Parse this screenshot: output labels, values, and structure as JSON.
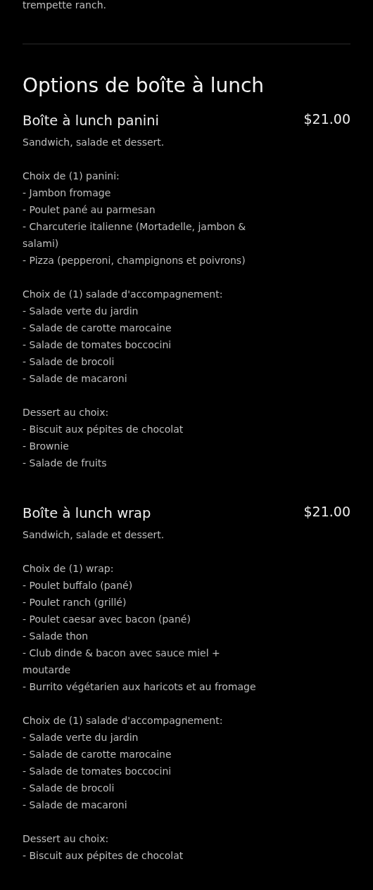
{
  "intro_tail": "trempette ranch.",
  "section_title": "Options de boîte à lunch",
  "items": [
    {
      "name": "Boîte à lunch panini",
      "price": "$21.00",
      "paragraphs": [
        [
          "Sandwich, salade et dessert."
        ],
        [
          "Choix de (1) panini:",
          "- Jambon fromage",
          "- Poulet pané au parmesan",
          "- Charcuterie italienne (Mortadelle, jambon & salami)",
          "- Pizza (pepperoni, champignons et poivrons)"
        ],
        [
          "Choix de (1) salade d'accompagnement:",
          "- Salade verte du jardin",
          "- Salade de carotte marocaine",
          "- Salade de tomates boccocini",
          "- Salade de brocoli",
          "- Salade de macaroni"
        ],
        [
          "Dessert au choix:",
          "- Biscuit aux pépites de chocolat",
          "- Brownie",
          "- Salade de fruits"
        ]
      ]
    },
    {
      "name": "Boîte à lunch wrap",
      "price": "$21.00",
      "paragraphs": [
        [
          "Sandwich, salade et dessert."
        ],
        [
          "Choix de (1) wrap:",
          "- Poulet buffalo (pané)",
          "- Poulet ranch (grillé)",
          "- Poulet caesar avec bacon (pané)",
          "- Salade thon",
          "- Club dinde & bacon avec sauce miel + moutarde",
          "- Burrito végétarien aux haricots et au fromage"
        ],
        [
          "Choix de (1) salade d'accompagnement:",
          "- Salade verte du jardin",
          "- Salade de carotte marocaine",
          "- Salade de tomates boccocini",
          "- Salade de brocoli",
          "- Salade de macaroni"
        ],
        [
          "Dessert au choix:",
          "- Biscuit aux pépites de chocolat"
        ]
      ]
    }
  ]
}
